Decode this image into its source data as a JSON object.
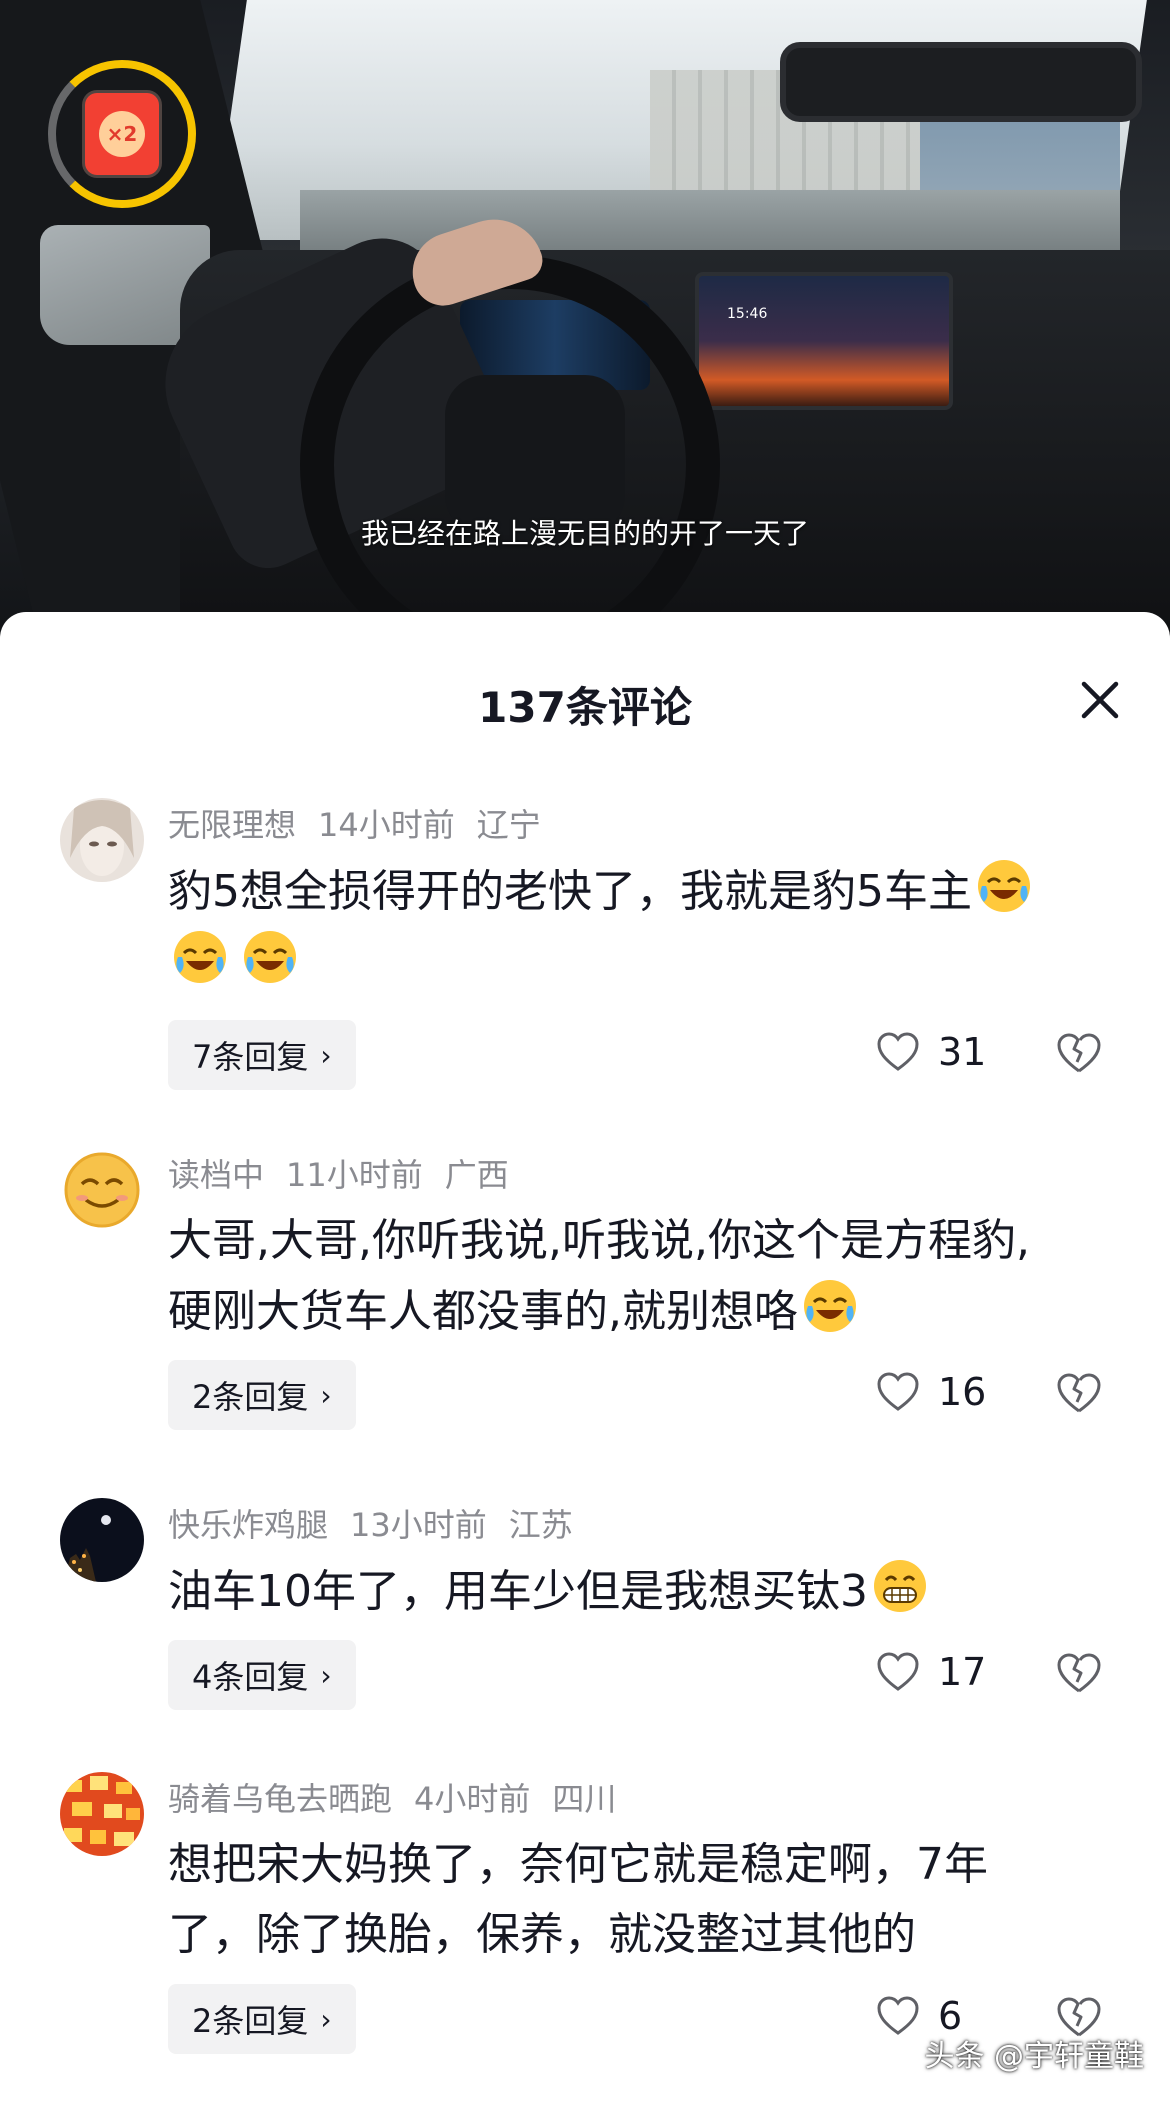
{
  "video": {
    "subtitle": "我已经在路上漫无目的的开了一天了",
    "screen_time": "15:46",
    "bonus_multiplier": "×2"
  },
  "sheet": {
    "title": "137条评论"
  },
  "comments": [
    {
      "user": "无限理想",
      "time": "14小时前",
      "location": "辽宁",
      "line1": "豹5想全损得开的老快了，我就是豹5车主",
      "line2": "",
      "replies": "7条回复",
      "likes": "31"
    },
    {
      "user": "读档中",
      "time": "11小时前",
      "location": "广西",
      "line1": "大哥,大哥,你听我说,听我说,你这个是方程豹,",
      "line2": "硬刚大货车人都没事的,就别想咯",
      "replies": "2条回复",
      "likes": "16"
    },
    {
      "user": "快乐炸鸡腿",
      "time": "13小时前",
      "location": "江苏",
      "line1": "油车10年了，用车少但是我想买钛3",
      "line2": "",
      "replies": "4条回复",
      "likes": "17"
    },
    {
      "user": "骑着乌龟去晒跑",
      "time": "4小时前",
      "location": "四川",
      "line1": "想把宋大妈换了，奈何它就是稳定啊，7年",
      "line2": "了，除了换胎，保养，就没整过其他的",
      "replies": "2条回复",
      "likes": "6"
    }
  ],
  "watermark": "头条 @宇轩童鞋",
  "colors": {
    "bonus_ring": "#f7c400",
    "red_packet": "#f24033",
    "meta_gray": "#8a8b91",
    "text": "#161823"
  }
}
